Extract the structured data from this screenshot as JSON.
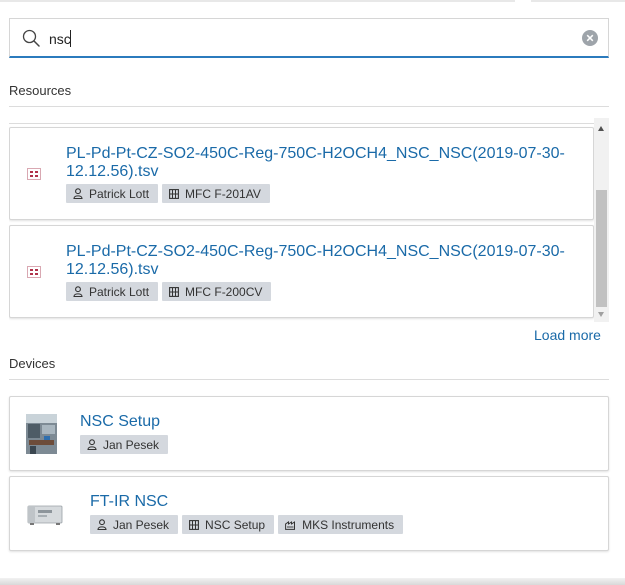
{
  "search": {
    "value": "nsc",
    "placeholder": ""
  },
  "sections": {
    "resources": "Resources",
    "devices": "Devices"
  },
  "resources": [
    {
      "title": "PL-Pd-Pt-CZ-SO2-450C-Reg-750C-H2OCH4_NSC_NSC(2019-07-30-12.12.56).tsv",
      "user": "Patrick Lott",
      "device": "MFC F-201AV"
    },
    {
      "title": "PL-Pd-Pt-CZ-SO2-450C-Reg-750C-H2OCH4_NSC_NSC(2019-07-30-12.12.56).tsv",
      "user": "Patrick Lott",
      "device": "MFC F-200CV"
    }
  ],
  "load_more": "Load more",
  "devices": [
    {
      "title": "NSC Setup",
      "user": "Jan Pesek"
    },
    {
      "title": "FT-IR NSC",
      "user": "Jan Pesek",
      "parent": "NSC Setup",
      "vendor": "MKS Instruments"
    }
  ],
  "icons": {
    "search": "search-icon",
    "clear": "clear-icon",
    "file": "data-file-icon",
    "user": "user-icon",
    "device": "device-icon",
    "vendor": "vendor-icon"
  },
  "colors": {
    "link": "#1a6aa8",
    "accent": "#2b7bbd",
    "tag_bg": "#d4d8de",
    "file_icon": "#b0324a"
  }
}
